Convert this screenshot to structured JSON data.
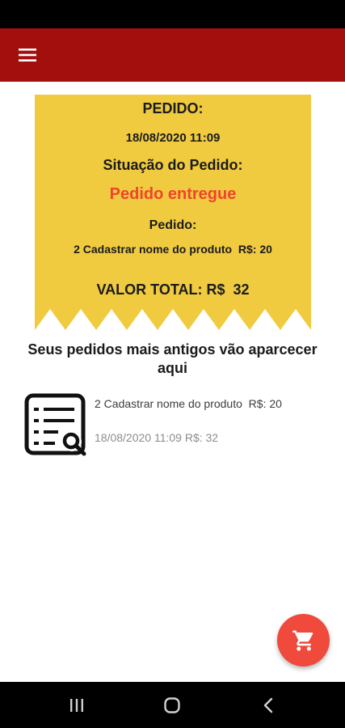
{
  "app_bar": {
    "menu_icon": "hamburger-menu-icon"
  },
  "receipt": {
    "title": "PEDIDO:",
    "datetime": "18/08/2020 11:09",
    "status_heading": "Situação do Pedido:",
    "status": "Pedido entregue",
    "items_heading": "Pedido:",
    "item_line": "2 Cadastrar nome do produto  R$: 20",
    "total": "VALOR TOTAL: R$  32",
    "colors": {
      "paper": "#f0cb40",
      "status": "#f0442c"
    }
  },
  "older_orders": {
    "heading": "Seus pedidos mais antigos vão aparcecer aqui",
    "items": [
      {
        "icon": "order-list-search-icon",
        "description": "2 Cadastrar nome do produto  R$: 20",
        "meta": "18/08/2020 11:09 R$: 32"
      }
    ]
  },
  "fab": {
    "icon": "shopping-cart-icon",
    "color": "#ef4a3b"
  },
  "nav": {
    "icons": [
      "recent-apps-icon",
      "home-icon",
      "back-icon"
    ]
  },
  "theme": {
    "app_bar": "#a30f0c"
  }
}
